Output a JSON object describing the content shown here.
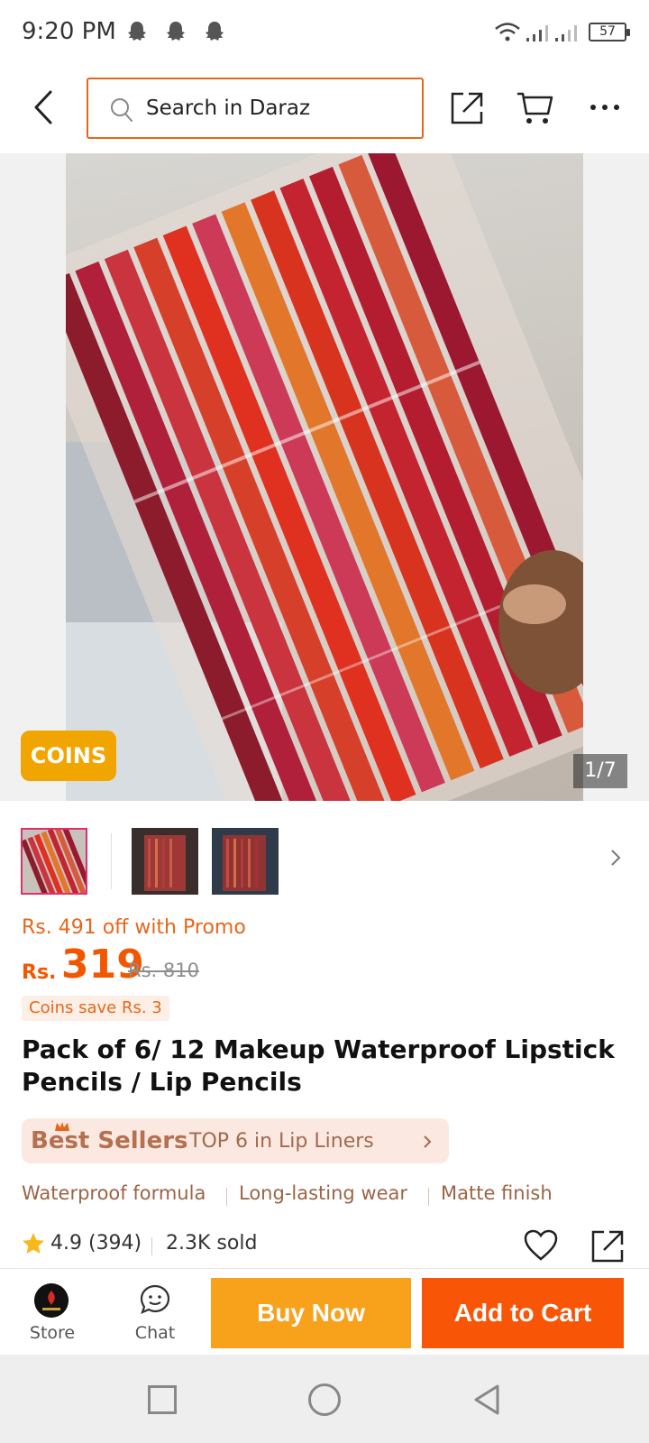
{
  "status_bar": {
    "time": "9:20 PM",
    "battery": "57"
  },
  "search": {
    "placeholder": "Search in Daraz"
  },
  "hero": {
    "coins_badge": "COINS",
    "page_indicator": "1/7"
  },
  "price": {
    "promo": "Rs. 491 off with Promo",
    "currency": "Rs.",
    "amount": "319",
    "original": "Rs. 810",
    "coins_save": "Coins save Rs. 3"
  },
  "product": {
    "title": "Pack of 6/ 12 Makeup Waterproof Lipstick Pencils / Lip Pencils"
  },
  "best_sellers": {
    "label": "Best Sellers",
    "rank": "TOP 6 in Lip Liners"
  },
  "features": [
    "Waterproof formula",
    "Long-lasting wear",
    "Matte finish"
  ],
  "rating": {
    "value": "4.9 (394)",
    "sold": "2.3K sold"
  },
  "actions": {
    "store": "Store",
    "chat": "Chat",
    "buy_now": "Buy Now",
    "add_to_cart": "Add to Cart"
  },
  "colors": {
    "accent": "#f85606",
    "buy_now": "#f8a11b",
    "promo": "#e8661b",
    "coins": "#f0a500",
    "feature_text": "#9c6446"
  },
  "icons": [
    "back-arrow-icon",
    "search-icon",
    "share-icon",
    "cart-icon",
    "more-icon",
    "chevron-right-icon",
    "star-icon",
    "heart-icon",
    "chat-icon",
    "home-square-icon",
    "home-circle-icon",
    "back-triangle-icon"
  ]
}
